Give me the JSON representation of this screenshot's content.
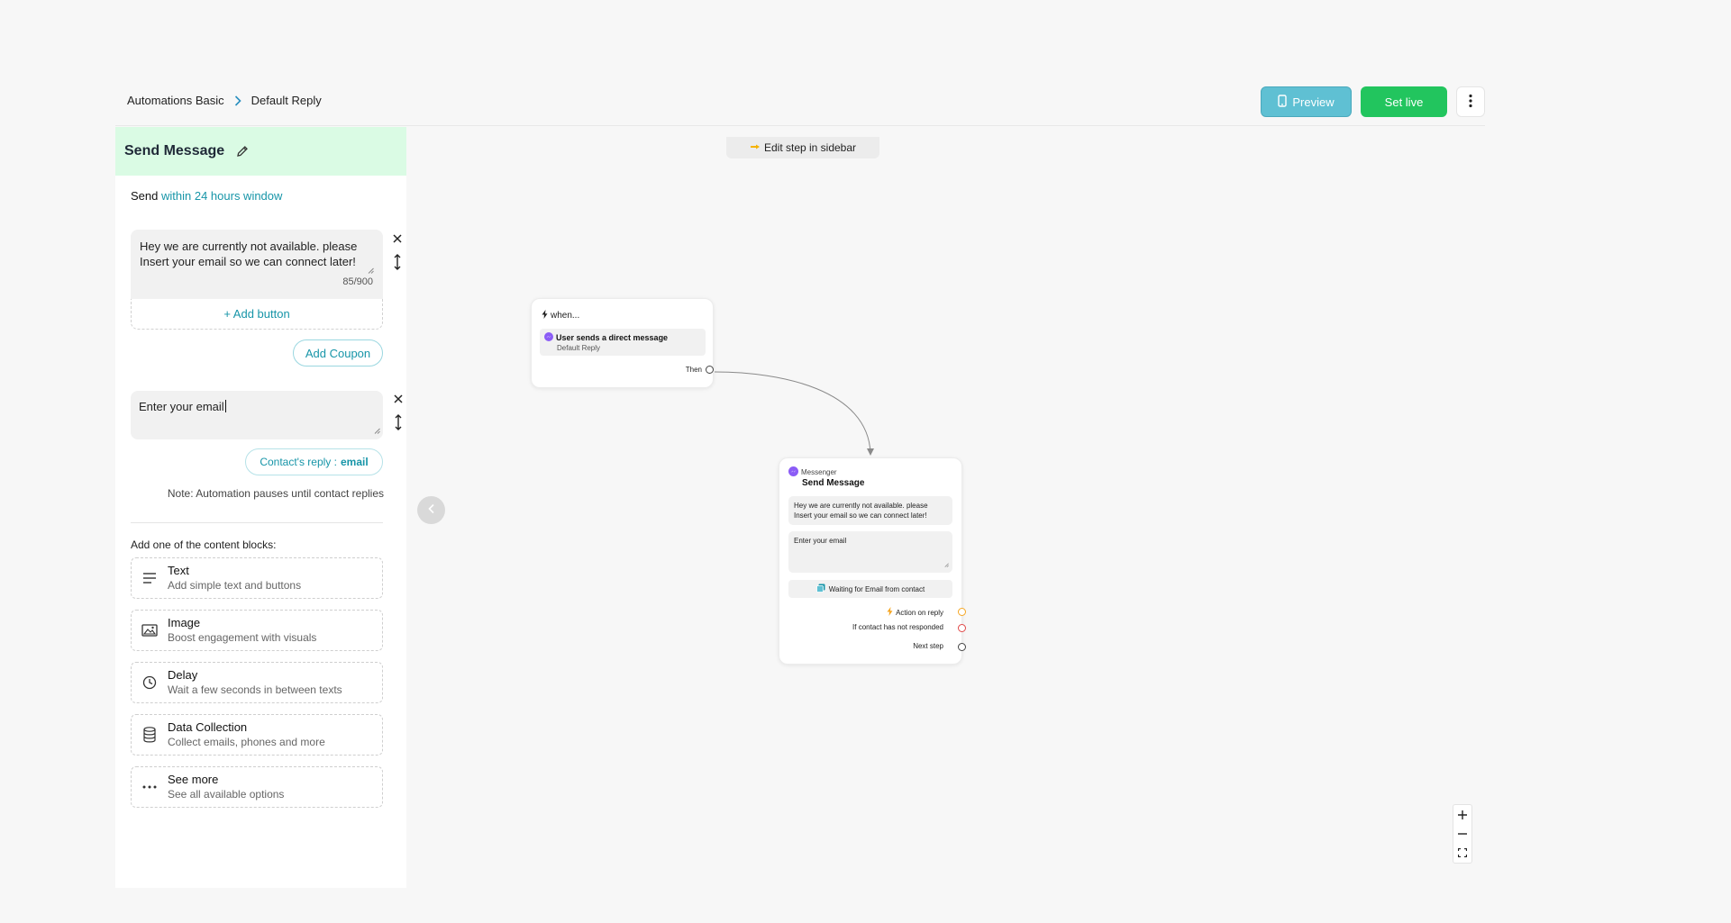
{
  "breadcrumb": {
    "root": "Automations Basic",
    "current": "Default Reply"
  },
  "toolbar": {
    "preview_label": "Preview",
    "setlive_label": "Set live"
  },
  "sidebar": {
    "title": "Send Message",
    "send_prefix": "Send",
    "send_window": "within 24 hours window",
    "message_text": "Hey we are currently not available. please Insert your email so we can connect later!",
    "message_count": "85/900",
    "add_button_label": "+ Add button",
    "add_coupon_label": "Add Coupon",
    "email_prompt": "Enter your email",
    "reply_chip_prefix": "Contact's reply :",
    "reply_chip_value": "email",
    "note": "Note: Automation pauses until contact replies",
    "blocks_heading": "Add one of the content blocks:",
    "blocks": [
      {
        "title": "Text",
        "subtitle": "Add simple text and buttons",
        "icon": "text-lines-icon"
      },
      {
        "title": "Image",
        "subtitle": "Boost engagement with visuals",
        "icon": "image-icon"
      },
      {
        "title": "Delay",
        "subtitle": "Wait a few seconds in between texts",
        "icon": "clock-icon"
      },
      {
        "title": "Data Collection",
        "subtitle": "Collect emails, phones and more",
        "icon": "database-icon"
      },
      {
        "title": "See more",
        "subtitle": "See all available options",
        "icon": "dots-icon"
      }
    ]
  },
  "canvas": {
    "edit_hint": "Edit step in sidebar",
    "trigger": {
      "when_label": "when...",
      "event": "User sends a direct message",
      "event_sub": "Default Reply",
      "then_label": "Then"
    },
    "message_node": {
      "channel": "Messenger",
      "title": "Send Message",
      "message_text": "Hey we are currently not available. please Insert your email so we can connect later!",
      "email_prompt": "Enter your email",
      "waiting_label": "Waiting for Email from contact",
      "action_on_reply": "Action on reply",
      "not_responded": "If contact has not responded",
      "next_step": "Next step"
    }
  },
  "colors": {
    "accent": "#1795a8",
    "preview": "#5fc0d3",
    "setlive": "#22c55e",
    "header_bg": "#dafbe4",
    "port_reply": "#f5a623",
    "port_noresp": "#e04848"
  }
}
